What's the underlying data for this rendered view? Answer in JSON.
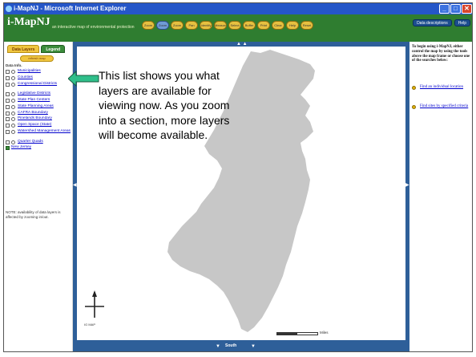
{
  "window": {
    "title": "i-MapNJ - Microsoft Internet Explorer",
    "buttons": [
      "_",
      "□",
      "✕"
    ]
  },
  "app": {
    "logo": "i-MapNJ",
    "tagline": "an interactive map of environmental protection",
    "toolbar": [
      "Zoom",
      "Zoom in",
      "Zoom out",
      "Pan",
      "Identify",
      "Measure",
      "Select",
      "Buffer",
      "Print",
      "Clear",
      "Help",
      "Reset"
    ],
    "active_tool_index": 1,
    "buttons": {
      "descriptions": "Data descriptions",
      "help": "Help"
    }
  },
  "left_panel": {
    "tabs": {
      "data": "Data Layers",
      "legend": "Legend"
    },
    "refresh_label": "refresh map",
    "heading": "Data Info.",
    "layers": [
      {
        "label": "Municipalities",
        "checked": false,
        "tall": false
      },
      {
        "label": "Counties",
        "checked": false,
        "tall": false
      },
      {
        "label": "Congressional Districts",
        "checked": false,
        "tall": true
      },
      {
        "label": "Legislative Districts",
        "checked": false,
        "tall": false
      },
      {
        "label": "State Plan Centers",
        "checked": false,
        "tall": false
      },
      {
        "label": "State Planning Areas",
        "checked": false,
        "tall": false
      },
      {
        "label": "CAFRA Boundary",
        "checked": false,
        "tall": false
      },
      {
        "label": "Pinelands Boundary",
        "checked": false,
        "tall": false
      },
      {
        "label": "Open Space (State)",
        "checked": false,
        "tall": false
      },
      {
        "label": "Watershed Management Areas",
        "checked": false,
        "tall": true
      },
      {
        "label": "Quarter Quads",
        "checked": false,
        "tall": false
      },
      {
        "label": "New Jersey",
        "checked": true,
        "tall": false
      }
    ],
    "note": "NOTE: availability of data layers is affected by zooming in/out."
  },
  "map": {
    "bottom_label": "South",
    "scale_label": "Miles",
    "compass_label": "IG MAP"
  },
  "right_panel": {
    "intro": "To begin using i-MapNJ, either control the map by using the tools above the map frame or choose one of the searches below:",
    "links": [
      "Find an individual location",
      "Find sites by specified criteria"
    ]
  },
  "callout": {
    "text": "This list shows you what layers are available for viewing now.   As you zoom into a section, more layers will become available."
  },
  "colors": {
    "map_fill": "#c7c7c7",
    "arrow_fill": "#2fbf8a",
    "app_green": "#2f7d30",
    "titlebar_blue": "#2556c8"
  }
}
